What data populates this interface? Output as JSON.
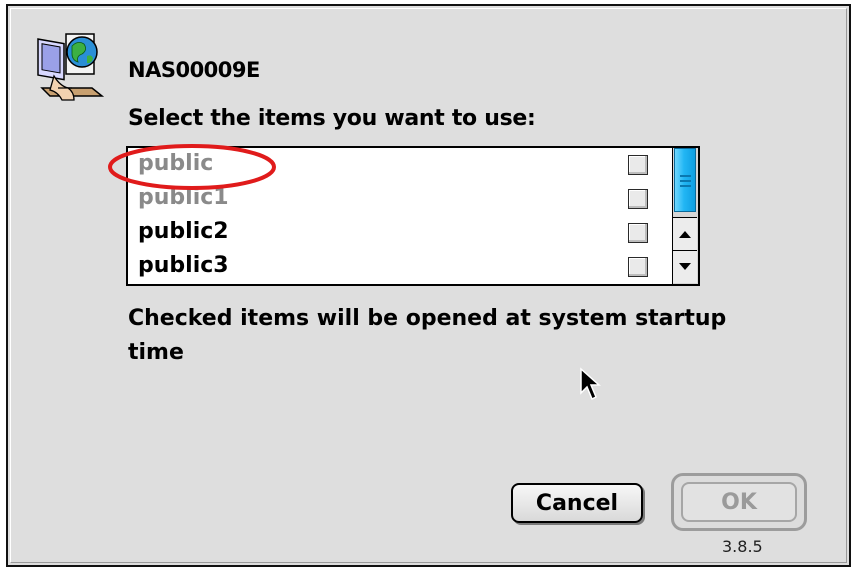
{
  "dialog": {
    "server_name": "NAS00009E",
    "prompt": "Select the items you want to use:",
    "footnote": "Checked items will be opened at system startup time",
    "version": "3.8.5"
  },
  "volume_list": {
    "items": [
      {
        "label": "public",
        "state": "dimmed",
        "checked": false
      },
      {
        "label": "public1",
        "state": "dimmed",
        "checked": false
      },
      {
        "label": "public2",
        "state": "normal",
        "checked": false
      },
      {
        "label": "public3",
        "state": "normal",
        "checked": false
      }
    ],
    "scrollbar_accent": "#22b6f4"
  },
  "buttons": {
    "cancel_label": "Cancel",
    "ok_label": "OK"
  },
  "annotation": {
    "shape": "ellipse",
    "color": "#e01b1b",
    "target": "public"
  },
  "icons": [
    "network-browser-icon",
    "mouse-pointer-icon",
    "scroll-up-arrow-icon",
    "scroll-down-arrow-icon"
  ]
}
